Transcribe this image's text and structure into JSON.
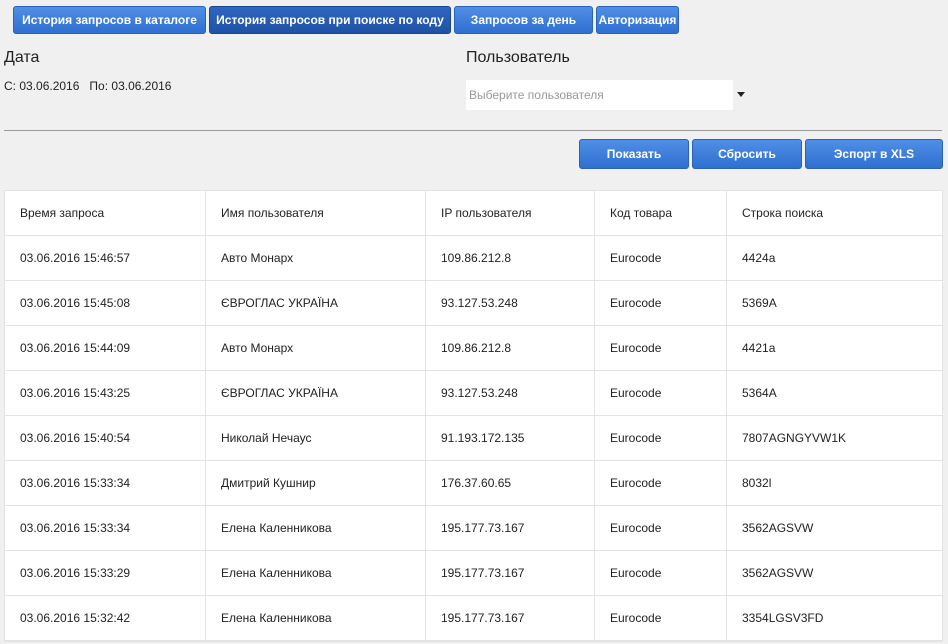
{
  "tabs": [
    {
      "label": "История запросов в каталоге"
    },
    {
      "label": "История запросов при поиске по коду",
      "active": true
    },
    {
      "label": "Запросов за день"
    },
    {
      "label": "Авторизация"
    }
  ],
  "filters": {
    "date_label": "Дата",
    "date_from_label": "С:",
    "date_from": "03.06.2016",
    "date_to_label": "По:",
    "date_to": "03.06.2016",
    "user_label": "Пользователь",
    "user_placeholder": "Выберите пользователя"
  },
  "actions": {
    "show": "Показать",
    "reset": "Сбросить",
    "export": "Эспорт в XLS"
  },
  "table": {
    "headers": [
      "Время запроса",
      "Имя пользователя",
      "IP пользователя",
      "Код товара",
      "Строка поиска"
    ],
    "rows": [
      [
        "03.06.2016 15:46:57",
        "Авто Монарх",
        "109.86.212.8",
        "Eurocode",
        "4424a"
      ],
      [
        "03.06.2016 15:45:08",
        "ЄВРОГЛАС УКРАЇНА",
        "93.127.53.248",
        "Eurocode",
        "5369A"
      ],
      [
        "03.06.2016 15:44:09",
        "Авто Монарх",
        "109.86.212.8",
        "Eurocode",
        "4421a"
      ],
      [
        "03.06.2016 15:43:25",
        "ЄВРОГЛАС УКРАЇНА",
        "93.127.53.248",
        "Eurocode",
        "5364A"
      ],
      [
        "03.06.2016 15:40:54",
        "Николай Нечаус",
        "91.193.172.135",
        "Eurocode",
        "7807AGNGYVW1K"
      ],
      [
        "03.06.2016 15:33:34",
        "Дмитрий Кушнир",
        "176.37.60.65",
        "Eurocode",
        "8032l"
      ],
      [
        "03.06.2016 15:33:34",
        "Елена Каленникова",
        "195.177.73.167",
        "Eurocode",
        "3562AGSVW"
      ],
      [
        "03.06.2016 15:33:29",
        "Елена Каленникова",
        "195.177.73.167",
        "Eurocode",
        "3562AGSVW"
      ],
      [
        "03.06.2016 15:32:42",
        "Елена Каленникова",
        "195.177.73.167",
        "Eurocode",
        "3354LGSV3FD"
      ]
    ]
  }
}
